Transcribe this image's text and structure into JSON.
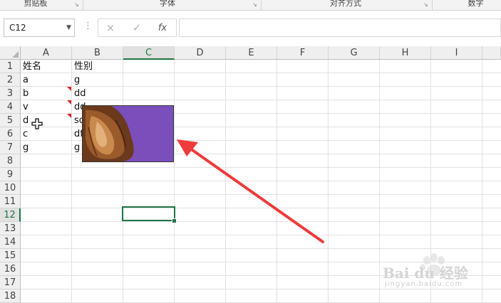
{
  "ribbon": {
    "groups": [
      "剪贴板",
      "字体",
      "对齐方式",
      "数字"
    ],
    "launcher_icon": "dialog-launcher-icon"
  },
  "formula_bar": {
    "name_box": "C12",
    "cancel_icon": "×",
    "enter_icon": "✓",
    "function_icon": "fx",
    "formula": ""
  },
  "sheet": {
    "columns": [
      "A",
      "B",
      "C",
      "D",
      "E",
      "F",
      "G",
      "H",
      "I"
    ],
    "selected_column": "C",
    "rows": [
      "1",
      "2",
      "3",
      "4",
      "5",
      "6",
      "7",
      "8",
      "9",
      "10",
      "11",
      "12",
      "13",
      "14",
      "15",
      "16",
      "17",
      "18"
    ],
    "selected_row": "12",
    "column_a": [
      "姓名",
      "a",
      "b",
      "v",
      "d",
      "c",
      "g"
    ],
    "column_b": [
      "性别",
      "g",
      "dd",
      "dd",
      "sd",
      "df",
      "g"
    ],
    "comment_indicator_rows": [
      "3",
      "4",
      "5"
    ],
    "active_cell": "C12"
  },
  "picture": {
    "description_icon": "dog-photo-image",
    "background": "#7a4fbc"
  },
  "annotation": {
    "arrow_color": "#ee3b3b"
  },
  "watermark": {
    "brand": "Bai du 经验",
    "url": "jingyan.baidu.com"
  },
  "colors": {
    "accent": "#217346",
    "grid": "#e1e1e1",
    "header_bg": "#efefef"
  }
}
